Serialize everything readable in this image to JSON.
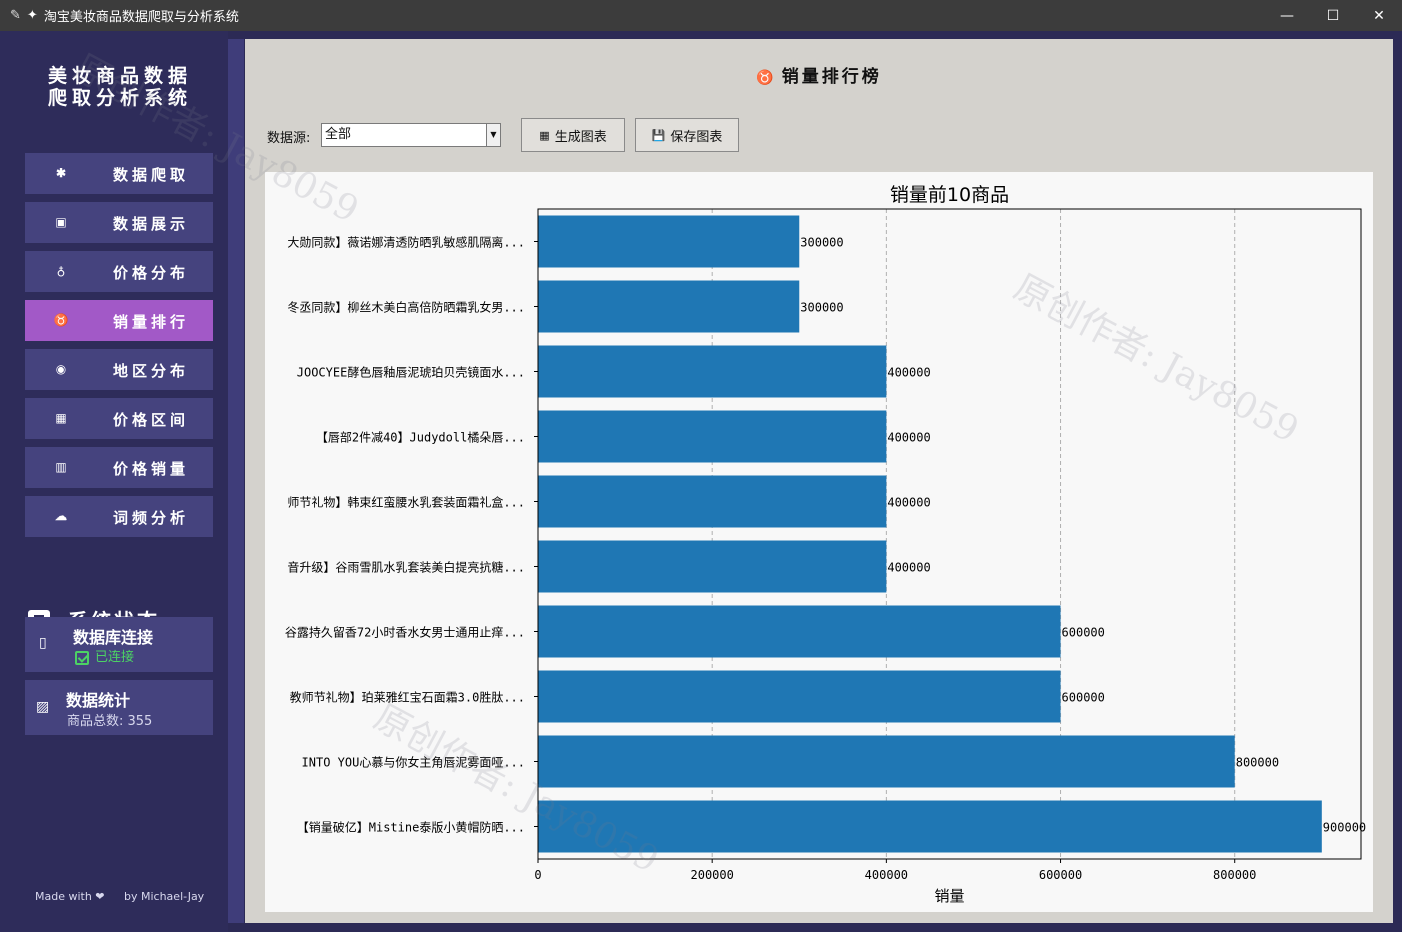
{
  "window": {
    "title": "淘宝美妆商品数据爬取与分析系统",
    "minimize": "—",
    "maximize": "☐",
    "close": "✕"
  },
  "sidebar": {
    "app_title_line1": "美妆商品数据",
    "app_title_line2": "爬取分析系统",
    "items": [
      {
        "label": "数据爬取",
        "icon": "spider-icon",
        "glyph": "✱"
      },
      {
        "label": "数据展示",
        "icon": "display-icon",
        "glyph": "▣"
      },
      {
        "label": "价格分布",
        "icon": "money-bag-icon",
        "glyph": "♁"
      },
      {
        "label": "销量排行",
        "icon": "medal-icon",
        "glyph": "♉"
      },
      {
        "label": "地区分布",
        "icon": "globe-icon",
        "glyph": "◉"
      },
      {
        "label": "价格区间",
        "icon": "chart-icon",
        "glyph": "▦"
      },
      {
        "label": "价格销量",
        "icon": "grid-icon",
        "glyph": "▥"
      },
      {
        "label": "词频分析",
        "icon": "cloud-icon",
        "glyph": "☁"
      }
    ],
    "active_index": 3,
    "status_title": "系统状态",
    "db_title": "数据库连接",
    "db_status": "已连接",
    "stats_title": "数据统计",
    "stats_text": "商品总数: 355",
    "footer_left": "Made with ❤",
    "footer_right": "by Michael-Jay"
  },
  "main": {
    "heading": "销量排行榜",
    "datasource_label": "数据源:",
    "datasource_value": "全部",
    "generate_label": "生成图表",
    "save_label": "保存图表"
  },
  "watermark_text": "原创作者: Jay8059",
  "chart_data": {
    "type": "bar",
    "orientation": "horizontal",
    "title": "销量前10商品",
    "xlabel": "销量",
    "ylabel": "",
    "xlim": [
      0,
      945000
    ],
    "xticks": [
      0,
      200000,
      400000,
      600000,
      800000
    ],
    "grid": "x-dashed",
    "categories": [
      "大勋同款】薇诺娜清透防晒乳敏感肌隔离...",
      "冬丞同款】柳丝木美白高倍防晒霜乳女男...",
      "JOOCYEE酵色唇釉唇泥琥珀贝壳镜面水...",
      "【唇部2件减40】Judydoll橘朵唇...",
      "师节礼物】韩束红蛮腰水乳套装面霜礼盒...",
      "音升级】谷雨雪肌水乳套装美白提亮抗糖...",
      "谷露持久留香72小时香水女男士通用止痒...",
      "教师节礼物】珀莱雅红宝石面霜3.0胜肽...",
      "INTO YOU心慕与你女主角唇泥雾面哑...",
      "【销量破亿】Mistine泰版小黄帽防晒..."
    ],
    "values": [
      300000,
      300000,
      400000,
      400000,
      400000,
      400000,
      600000,
      600000,
      800000,
      900000
    ],
    "bar_color": "#1f77b4"
  }
}
